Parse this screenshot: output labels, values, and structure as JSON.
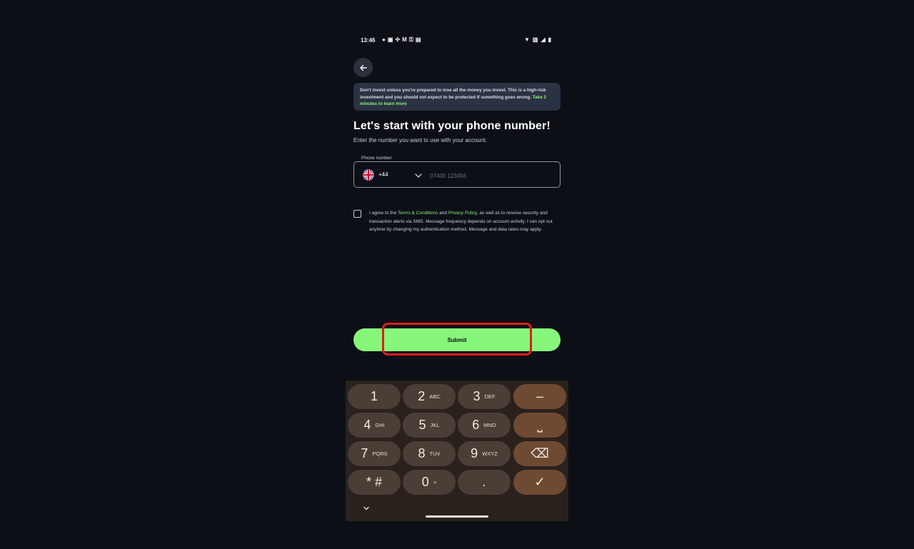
{
  "status_bar": {
    "time": "13:46",
    "left_icons": [
      "chat-icon",
      "image-icon",
      "fan-icon",
      "mail-icon",
      "key-icon",
      "calendar-icon"
    ],
    "right_icons": [
      "wifi-icon",
      "sim-icon",
      "signal-icon",
      "battery-icon"
    ]
  },
  "risk_banner": {
    "text": "Don't invest unless you're prepared to lose all the money you invest. This is a high-risk investment and you should not expect to be protected if something goes wrong.",
    "link": "Take 2 minutes to learn more"
  },
  "title": "Let's start with your phone number!",
  "subtitle": "Enter the number you want to use with your account.",
  "phone": {
    "label": "Phone number",
    "country_code": "+44",
    "placeholder": "07400 123456",
    "value": ""
  },
  "consent": {
    "prefix": "I agree to the ",
    "terms_link": "Terms & Conditions",
    "and": " and ",
    "privacy_link": "Privacy Policy",
    "rest": ", as well as to receive security and transaction alerts via SMS. Message frequency depends on account activity. I can opt out anytime by changing my authentication method. Message and data rates may apply."
  },
  "submit_label": "Submit",
  "keyboard": {
    "rows": [
      [
        {
          "main": "1",
          "sub": ""
        },
        {
          "main": "2",
          "sub": "ABC"
        },
        {
          "main": "3",
          "sub": "DEF"
        },
        {
          "main": "–",
          "sub": "",
          "action": true
        }
      ],
      [
        {
          "main": "4",
          "sub": "GHI"
        },
        {
          "main": "5",
          "sub": "JKL"
        },
        {
          "main": "6",
          "sub": "MNO"
        },
        {
          "main": "⎵",
          "sub": "",
          "action": true
        }
      ],
      [
        {
          "main": "7",
          "sub": "PQRS"
        },
        {
          "main": "8",
          "sub": "TUV"
        },
        {
          "main": "9",
          "sub": "WXYZ"
        },
        {
          "main": "⌫",
          "sub": "",
          "action": true
        }
      ],
      [
        {
          "main": "* #",
          "sub": ""
        },
        {
          "main": "0",
          "sub": "+"
        },
        {
          "main": ".",
          "sub": ""
        },
        {
          "main": "✓",
          "sub": "",
          "action": true
        }
      ]
    ]
  },
  "colors": {
    "background": "#0c1016",
    "accent_green": "#86f77a",
    "link_green": "#8cf07a",
    "banner": "#2a3243",
    "highlight": "#e31c1c",
    "keyboard_bg": "#2a211c",
    "key_bg": "#4a3e37",
    "key_action_bg": "#6e4a33"
  }
}
